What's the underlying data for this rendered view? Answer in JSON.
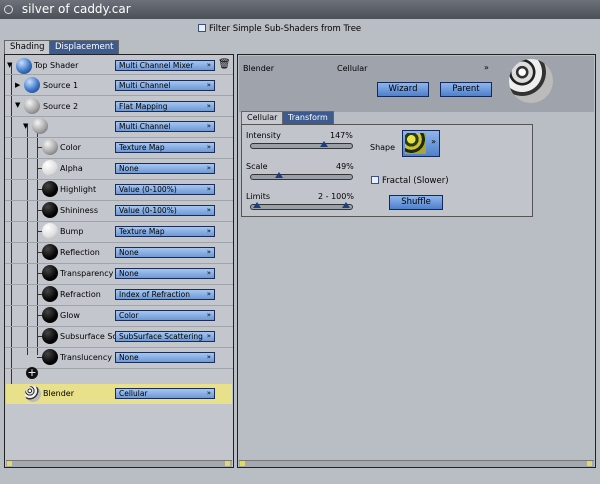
{
  "window": {
    "title": "silver of caddy.car"
  },
  "filter": {
    "label": "Filter Simple Sub-Shaders from Tree"
  },
  "left_tabs": [
    {
      "label": "Shading"
    },
    {
      "label": "Displacement"
    }
  ],
  "tree": {
    "top_shader": {
      "label": "Top Shader",
      "value": "Multi Channel Mixer"
    },
    "source1": {
      "label": "Source 1",
      "value": "Multi Channel"
    },
    "source2": {
      "label": "Source 2",
      "value": "Flat Mapping"
    },
    "sub": {
      "label": "",
      "value": "Multi Channel"
    },
    "channels": [
      {
        "label": "Color",
        "value": "Texture Map",
        "sphere": "gray"
      },
      {
        "label": "Alpha",
        "value": "None",
        "sphere": "white"
      },
      {
        "label": "Highlight",
        "value": "Value (0-100%)",
        "sphere": "black"
      },
      {
        "label": "Shininess",
        "value": "Value (0-100%)",
        "sphere": "black"
      },
      {
        "label": "Bump",
        "value": "Texture Map",
        "sphere": "white"
      },
      {
        "label": "Reflection",
        "value": "None",
        "sphere": "black"
      },
      {
        "label": "Transparency",
        "value": "None",
        "sphere": "black"
      },
      {
        "label": "Refraction",
        "value": "Index of Refraction",
        "sphere": "black"
      },
      {
        "label": "Glow",
        "value": "Color",
        "sphere": "black"
      },
      {
        "label": "Subsurface Sc",
        "value": "SubSurface Scattering",
        "sphere": "black"
      },
      {
        "label": "Translucency",
        "value": "None",
        "sphere": "black"
      }
    ],
    "blender": {
      "label": "Blender",
      "value": "Cellular"
    }
  },
  "editor": {
    "name": "Blender",
    "type": "Cellular",
    "wizard": "Wizard",
    "parent": "Parent",
    "tabs": [
      {
        "label": "Cellular"
      },
      {
        "label": "Transform"
      }
    ],
    "intensity": {
      "label": "Intensity",
      "value": "147%",
      "fraction": 0.73
    },
    "scale": {
      "label": "Scale",
      "value": "49%",
      "fraction": 0.25
    },
    "limits": {
      "label": "Limits",
      "value": "2 - 100%",
      "low": 0.02,
      "high": 1.0
    },
    "shape": {
      "label": "Shape"
    },
    "fractal": {
      "label": "Fractal (Slower)"
    },
    "shuffle": "Shuffle"
  },
  "colors": {
    "dropdown": "#6e9ad6",
    "highlight": "#e8e08b",
    "window": "#b9bdc4"
  }
}
